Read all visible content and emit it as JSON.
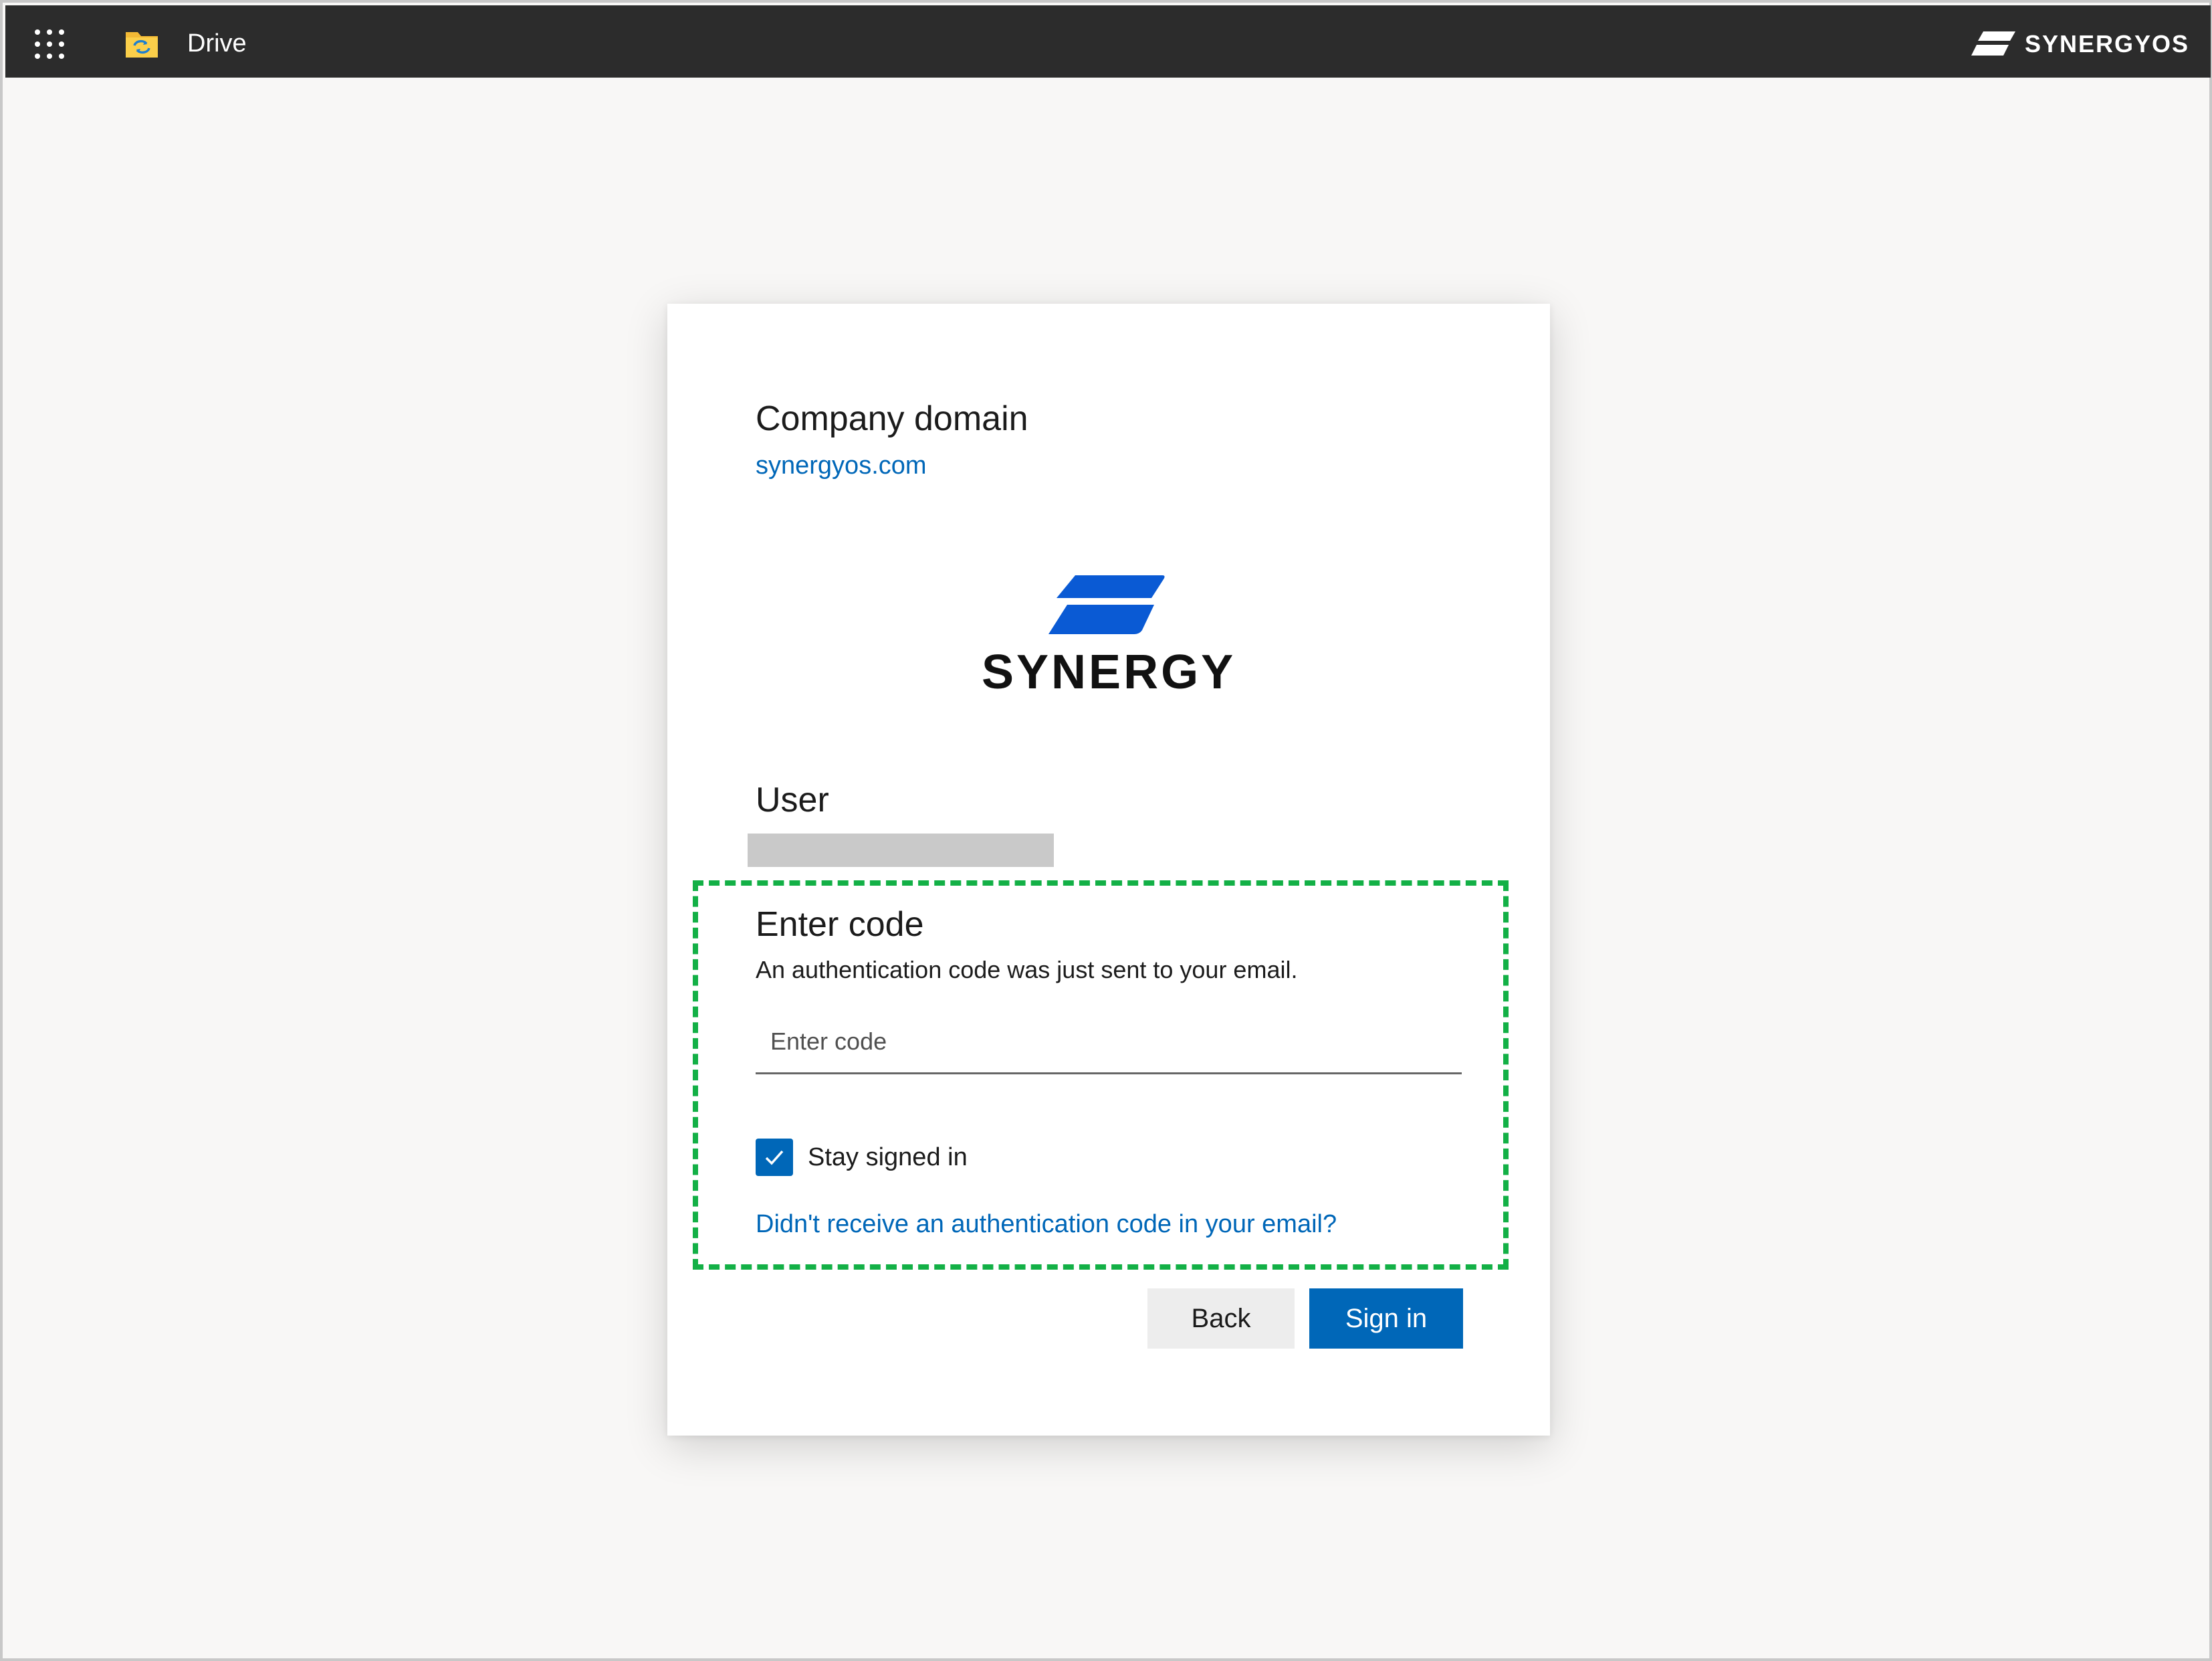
{
  "topbar": {
    "app_title": "Drive",
    "app_icon": "folder-sync-icon",
    "waffle_icon": "app-launcher-icon",
    "brand_text": "SYNERGYOS",
    "background": "#2c2c2c"
  },
  "card": {
    "domain_label": "Company domain",
    "domain_value": "synergyos.com",
    "logo_text": "SYNERGY",
    "user_label": "User",
    "enter_code_title": "Enter code",
    "enter_code_description": "An authentication code was just sent to your email.",
    "code_input": {
      "placeholder": "Enter code",
      "value": ""
    },
    "stay_signed_in": {
      "label": "Stay signed in",
      "checked": true
    },
    "resend_link": "Didn't receive an authentication code in your email?",
    "back_button": "Back",
    "signin_button": "Sign in"
  },
  "colors": {
    "accent_blue": "#0067b8",
    "logo_blue": "#0a5ad4",
    "highlight_green": "#13b046",
    "page_background": "#f8f7f6"
  }
}
